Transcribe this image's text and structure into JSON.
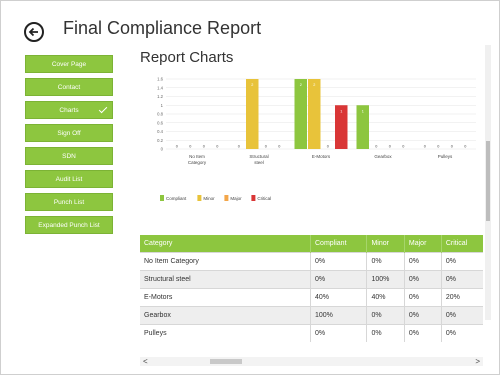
{
  "header": {
    "title": "Final Compliance Report"
  },
  "sidebar": {
    "items": [
      {
        "label": "Cover Page"
      },
      {
        "label": "Contact"
      },
      {
        "label": "Charts",
        "active": true
      },
      {
        "label": "Sign Off"
      },
      {
        "label": "SDN"
      },
      {
        "label": "Audit List"
      },
      {
        "label": "Punch List"
      },
      {
        "label": "Expanded Punch List"
      }
    ]
  },
  "main": {
    "section_title": "Report Charts"
  },
  "colors": {
    "compliant": "#8dc63f",
    "minor": "#e8c33a",
    "major": "#f3a64a",
    "critical": "#d93636",
    "accent": "#8dc63f"
  },
  "chart_data": {
    "type": "bar",
    "categories": [
      "No Item Category",
      "Structural steel",
      "E-Motors",
      "Gearbox",
      "Pulleys"
    ],
    "series": [
      {
        "name": "Compliant",
        "values": [
          0,
          0,
          2,
          1,
          0
        ]
      },
      {
        "name": "Minor",
        "values": [
          0,
          2,
          2,
          0,
          0
        ]
      },
      {
        "name": "Major",
        "values": [
          0,
          0,
          0,
          0,
          0
        ]
      },
      {
        "name": "Critical",
        "values": [
          0,
          0,
          1,
          0,
          0
        ]
      }
    ],
    "ylim": [
      0,
      1.6
    ],
    "yticks": [
      "1.6",
      "1.4",
      "1.2",
      "1",
      "0.8",
      "0.6",
      "0.4",
      "0.2",
      "0"
    ],
    "legend": "bottom-left"
  },
  "table": {
    "headers": [
      "Category",
      "Compliant",
      "Minor",
      "Major",
      "Critical"
    ],
    "rows": [
      [
        "No Item Category",
        "0%",
        "0%",
        "0%",
        "0%"
      ],
      [
        "Structural steel",
        "0%",
        "100%",
        "0%",
        "0%"
      ],
      [
        "E-Motors",
        "40%",
        "40%",
        "0%",
        "20%"
      ],
      [
        "Gearbox",
        "100%",
        "0%",
        "0%",
        "0%"
      ],
      [
        "Pulleys",
        "0%",
        "0%",
        "0%",
        "0%"
      ]
    ]
  },
  "scroll": {
    "left_arrow": "<",
    "right_arrow": ">"
  }
}
